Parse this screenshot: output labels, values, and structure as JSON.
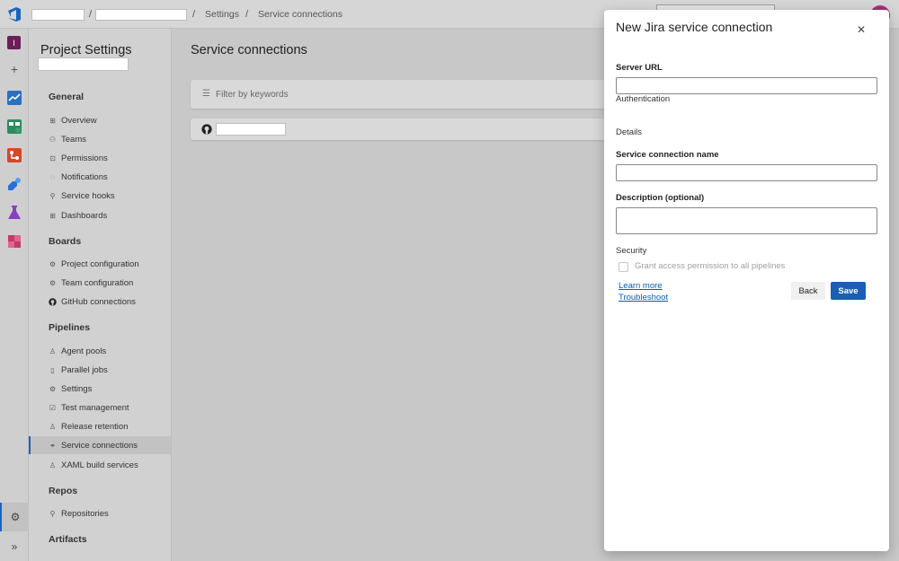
{
  "breadcrumb": {
    "sep": "/",
    "settings": "Settings",
    "current": "Service connections"
  },
  "colors": {
    "accent": "#1a63c0",
    "primary_button": "#1a5fb4",
    "avatar": "#a0327c",
    "link": "#0f5ca8"
  },
  "rail": {
    "project_initial": "I",
    "add": "+",
    "icons": [
      "overview-icon",
      "boards-icon",
      "repos-icon",
      "pipelines-icon",
      "test-plans-icon",
      "artifacts-icon"
    ],
    "settings_glyph": "⚙",
    "expand_glyph": "»"
  },
  "nav": {
    "title": "Project Settings",
    "groups": {
      "general": "General",
      "boards": "Boards",
      "pipelines": "Pipelines",
      "repos": "Repos",
      "artifacts": "Artifacts"
    },
    "items": {
      "overview": "Overview",
      "teams": "Teams",
      "permissions": "Permissions",
      "notifications": "Notifications",
      "service_hooks": "Service hooks",
      "dashboards": "Dashboards",
      "project_configuration": "Project configuration",
      "team_configuration": "Team configuration",
      "github_connections": "GitHub connections",
      "agent_pools": "Agent pools",
      "parallel_jobs": "Parallel jobs",
      "settings": "Settings",
      "test_management": "Test management",
      "release_retention": "Release retention",
      "service_connections": "Service connections",
      "xaml_build_services": "XAML build services",
      "repositories": "Repositories"
    }
  },
  "main": {
    "title": "Service connections",
    "filter_placeholder": "Filter by keywords"
  },
  "panel": {
    "title": "New Jira service connection",
    "close_glyph": "✕",
    "server_url_label": "Server URL",
    "server_url_value": "",
    "authentication_label": "Authentication",
    "details_label": "Details",
    "name_label": "Service connection name",
    "name_value": "",
    "description_label": "Description (optional)",
    "description_value": "",
    "security_label": "Security",
    "grant_access_label": "Grant access permission to all pipelines",
    "grant_access_checked": false,
    "learn_more": "Learn more",
    "troubleshoot": "Troubleshoot",
    "back_button": "Back",
    "save_button": "Save"
  }
}
